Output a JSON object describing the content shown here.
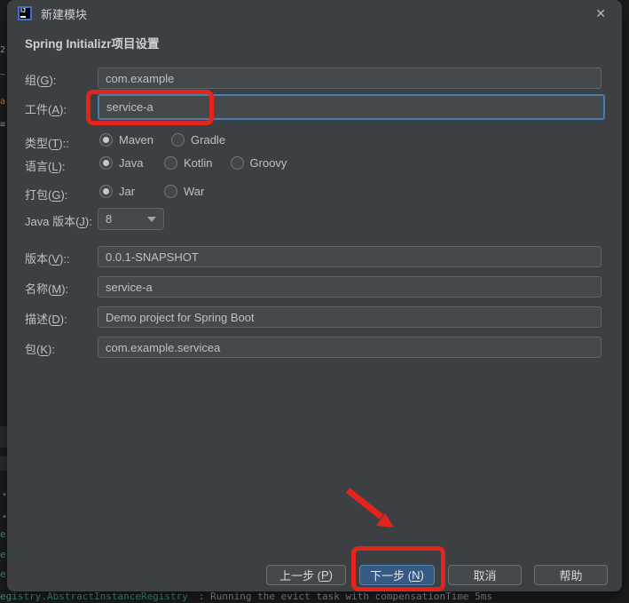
{
  "window": {
    "title": "新建模块",
    "icon_text": "IJ",
    "close_glyph": "✕"
  },
  "header": {
    "title": "Spring Initializr项目设置"
  },
  "form": {
    "group": {
      "label": {
        "pre": "组(",
        "key": "G",
        "post": "):"
      },
      "value": "com.example"
    },
    "artifact": {
      "label": {
        "pre": "工件(",
        "key": "A",
        "post": "):"
      },
      "value": "service-a"
    },
    "type": {
      "label": {
        "pre": "类型(",
        "key": "T",
        "post": ")::"
      },
      "options": [
        {
          "label": "Maven",
          "selected": true
        },
        {
          "label": "Gradle",
          "selected": false
        }
      ]
    },
    "language": {
      "label": {
        "pre": "语言(",
        "key": "L",
        "post": "):"
      },
      "options": [
        {
          "label": "Java",
          "selected": true
        },
        {
          "label": "Kotlin",
          "selected": false
        },
        {
          "label": "Groovy",
          "selected": false
        }
      ]
    },
    "packaging": {
      "label": {
        "pre": "打包(",
        "key": "G",
        "post": "):"
      },
      "options": [
        {
          "label": "Jar",
          "selected": true
        },
        {
          "label": "War",
          "selected": false
        }
      ]
    },
    "java_version": {
      "label": {
        "pre": "Java 版本(",
        "key": "J",
        "post": "):"
      },
      "value": "8"
    },
    "version": {
      "label": {
        "pre": "版本(",
        "key": "V",
        "post": ")::"
      },
      "value": "0.0.1-SNAPSHOT"
    },
    "name": {
      "label": {
        "pre": "名称(",
        "key": "M",
        "post": "):"
      },
      "value": "service-a"
    },
    "description": {
      "label": {
        "pre": "描述(",
        "key": "D",
        "post": "):"
      },
      "value": "Demo project for Spring Boot"
    },
    "package": {
      "label": {
        "pre": "包(",
        "key": "K",
        "post": "):"
      },
      "value": "com.example.servicea"
    }
  },
  "buttons": {
    "prev": {
      "pre": "上一步 (",
      "key": "P",
      "post": ")"
    },
    "next": {
      "pre": "下一步 (",
      "key": "N",
      "post": ")"
    },
    "cancel": "取消",
    "help": "帮助"
  },
  "log": {
    "logger": "egistry.AbstractInstanceRegistry",
    "message": ": Running the evict task with compensationTime 5ms"
  },
  "annotations": {
    "color": "#e3241c"
  },
  "background": {
    "fragments": {
      "num": "2",
      "green1": "~",
      "orange": "a",
      "green2": "≡",
      "dot": "•",
      "e": "e"
    }
  }
}
